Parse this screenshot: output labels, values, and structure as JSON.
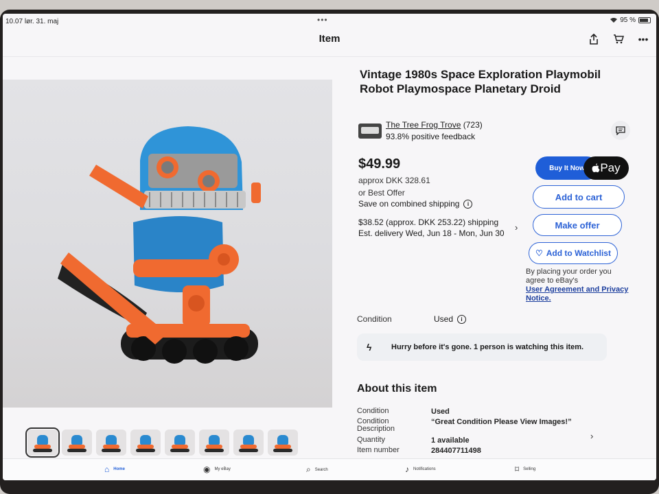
{
  "status": {
    "time": "10.07",
    "date": "lør. 31. maj",
    "battery": "95 %"
  },
  "nav": {
    "title": "Item",
    "icons": [
      "share-icon",
      "cart-icon",
      "more-icon"
    ]
  },
  "listing": {
    "title": "Vintage 1980s Space Exploration Playmobil Robot Playmospace Planetary Droid",
    "seller_name": "The Tree Frog Trove",
    "seller_count": "(723)",
    "feedback": "93.8% positive feedback",
    "price": "$49.99",
    "approx": "approx DKK 328.61",
    "best_offer": "or Best Offer",
    "combined_shipping": "Save on combined shipping",
    "shipping_line1": "$38.52 (approx. DKK 253.22) shipping",
    "shipping_line2": "Est. delivery Wed, Jun 18 - Mon, Jun 30"
  },
  "actions": {
    "buy_now": "Buy It Now",
    "apple_pay": "Pay",
    "add_to_cart": "Add to cart",
    "make_offer": "Make offer",
    "watchlist": "Add to Watchlist"
  },
  "legal": {
    "text": "By placing your order you agree to eBay's",
    "link": "User Agreement and Privacy Notice."
  },
  "condition": {
    "label": "Condition",
    "value": "Used"
  },
  "hurry": "Hurry before it's gone. 1 person is watching this item.",
  "about": {
    "heading": "About this item",
    "rows": [
      {
        "label": "Condition",
        "value": "Used"
      },
      {
        "label": "Condition Description",
        "value": "“Great Condition Please View Images!”"
      },
      {
        "label": "Quantity",
        "value": "1 available"
      },
      {
        "label": "Item number",
        "value": "284407711498"
      }
    ]
  },
  "tabs": [
    "Home",
    "My eBay",
    "Search",
    "Notifications",
    "Selling"
  ],
  "colors": {
    "accent": "#1f5ed8",
    "robot_blue": "#2a8ad0",
    "robot_orange": "#f06a30"
  }
}
